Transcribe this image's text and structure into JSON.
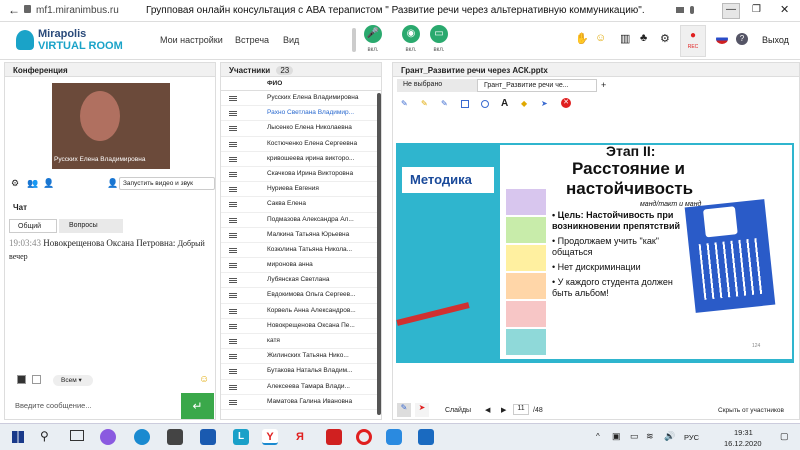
{
  "browser": {
    "url": "mf1.miranimbus.ru",
    "title": "Групповая онлайн консультация с АВА терапистом \" Развитие речи через альтернативную коммуникацию\"."
  },
  "app": {
    "logo_line1": "Mirapolis",
    "logo_line2": "VIRTUAL ROOM",
    "menu": [
      "Мои настройки",
      "Встреча",
      "Вид"
    ],
    "mic_label": "вкл.",
    "cam_label": "вкл.",
    "screen_label": "вкл.",
    "rec_label": "REC",
    "exit_label": "Выход"
  },
  "conference": {
    "header": "Конференция",
    "video_name": "Русских Елена Владимировна",
    "start_video_label": "Запустить видео и звук"
  },
  "chat": {
    "header": "Чат",
    "tabs": [
      "Общий",
      "Вопросы"
    ],
    "message_time": "19:03:43",
    "message_author": "Новокрещенова Оксана Петровна:",
    "message_text": "Добрый вечер",
    "recipient": "Всем",
    "input_placeholder": "Введите сообщение..."
  },
  "participants": {
    "header": "Участники",
    "count": "23",
    "column": "ФИО",
    "names": [
      "Русских Елена Владимировна",
      "Рахно Светлана Владимир...",
      "Лысенко Елена Николаевна",
      "Костюченко Елена Сергеевна",
      "кривошеева ирина викторо...",
      "Скачкова Ирина Викторовна",
      "Нуриева Евгения",
      "Саква Елена",
      "Подмазова Александра Ал...",
      "Малкина Татьяна Юрьевна",
      "Козюлина Татьяна Никола...",
      "миронова анна",
      "Лубянская Светлана",
      "Евдокимова Ольга Сергеев...",
      "Корвель Анна Александров...",
      "Новокрещенова Оксана Пе...",
      "катя",
      "Жилинских Татьяна Нико...",
      "Бутакова Наталья Владим...",
      "Алексеева Тамара Влади...",
      "Маматова Галина Ивановна"
    ]
  },
  "presentation": {
    "header": "Грант_Развитие речи через АСК.pptx",
    "tabs": [
      "Не выбрано",
      "Грант_Развитие речи че..."
    ],
    "tab_add": "+",
    "slides_label": "Слайды",
    "current_slide": "11",
    "total_slides": "/48",
    "hide_label": "Скрыть от участников"
  },
  "slide": {
    "banner": "Методика",
    "stage": "Этап II:",
    "title_line1": "Расстояние и",
    "title_line2": "настойчивость",
    "subtitle": "манд/такт и манд",
    "bullets": [
      "Цель: Настойчивость при возникновении препятствий",
      "Продолжаем учить \"как\" общаться",
      "Нет дискриминации",
      "У каждого студента должен быть альбом!"
    ],
    "page_num": "124"
  },
  "taskbar": {
    "lang": "РУС",
    "time": "19:31",
    "date": "16.12.2020"
  }
}
